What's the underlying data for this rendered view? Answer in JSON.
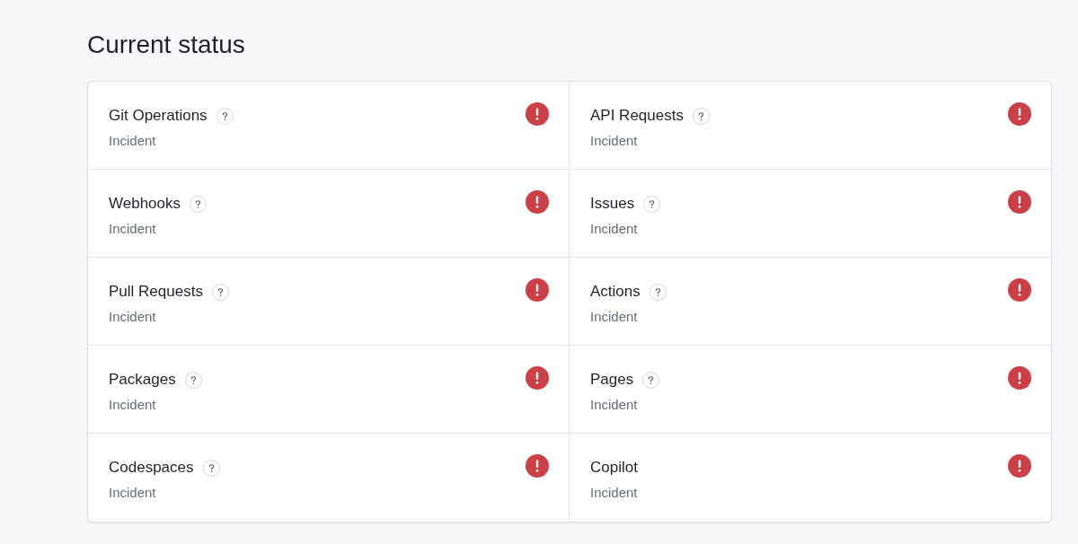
{
  "title": "Current status",
  "components": [
    {
      "name": "Git Operations",
      "help": true,
      "status": "Incident",
      "kind": "incident"
    },
    {
      "name": "API Requests",
      "help": true,
      "status": "Incident",
      "kind": "incident"
    },
    {
      "name": "Webhooks",
      "help": true,
      "status": "Incident",
      "kind": "incident"
    },
    {
      "name": "Issues",
      "help": true,
      "status": "Incident",
      "kind": "incident"
    },
    {
      "name": "Pull Requests",
      "help": true,
      "status": "Incident",
      "kind": "incident"
    },
    {
      "name": "Actions",
      "help": true,
      "status": "Incident",
      "kind": "incident"
    },
    {
      "name": "Packages",
      "help": true,
      "status": "Incident",
      "kind": "incident"
    },
    {
      "name": "Pages",
      "help": true,
      "status": "Incident",
      "kind": "incident"
    },
    {
      "name": "Codespaces",
      "help": true,
      "status": "Incident",
      "kind": "incident"
    },
    {
      "name": "Copilot",
      "help": false,
      "status": "Incident",
      "kind": "incident"
    }
  ]
}
